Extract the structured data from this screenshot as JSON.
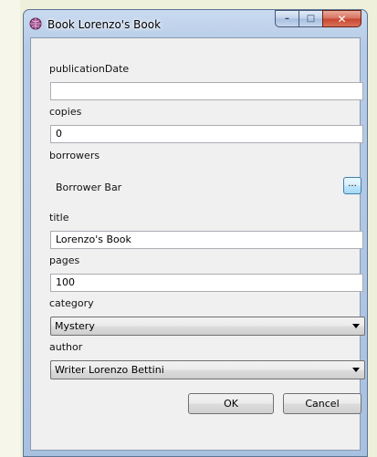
{
  "window": {
    "title": "Book Lorenzo's Book",
    "minimize_glyph": "–",
    "maximize_glyph": "□",
    "close_glyph": "✕"
  },
  "form": {
    "publicationDate": {
      "label": "publicationDate",
      "value": ""
    },
    "copies": {
      "label": "copies",
      "value": "0"
    },
    "borrowers": {
      "label": "borrowers",
      "value": "Borrower Bar",
      "button_label": "..."
    },
    "title": {
      "label": "title",
      "value": "Lorenzo's Book"
    },
    "pages": {
      "label": "pages",
      "value": "100"
    },
    "category": {
      "label": "category",
      "selected": "Mystery"
    },
    "author": {
      "label": "author",
      "selected": "Writer Lorenzo Bettini"
    }
  },
  "buttons": {
    "ok": "OK",
    "cancel": "Cancel"
  },
  "colors": {
    "titlebar": "#b6cbe6",
    "close_button": "#c7462f",
    "dialog_bg": "#f0f0f0"
  },
  "icons": {
    "title": "book-globe-icon"
  }
}
